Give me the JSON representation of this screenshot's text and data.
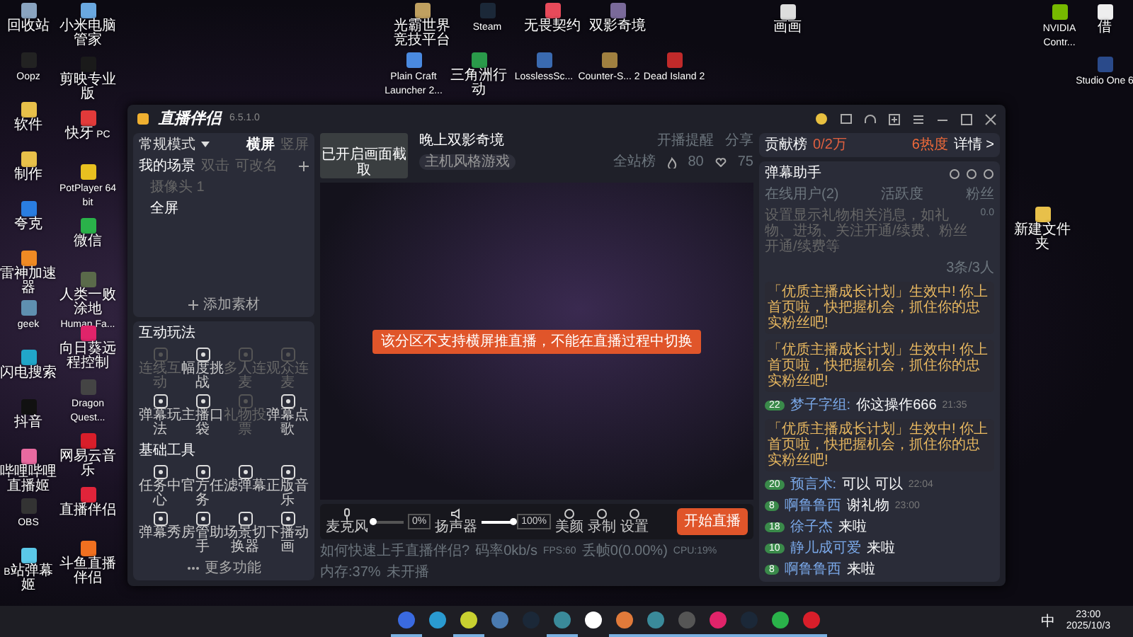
{
  "desktop": {
    "left_columns": [
      [
        {
          "label": "回收站",
          "color": "#8aa4c0"
        },
        {
          "label": "Oopz",
          "color": "#222222"
        },
        {
          "label": "软件",
          "color": "#e8c04a"
        },
        {
          "label": "制作",
          "color": "#e8c04a"
        },
        {
          "label": "夸克",
          "color": "#2a7de1"
        },
        {
          "label": "雷神加速器",
          "color": "#f08a24"
        },
        {
          "label": "geek",
          "color": "#5f8fb0"
        },
        {
          "label": "闪电搜索",
          "color": "#21a6c9"
        },
        {
          "label": "抖音",
          "color": "#111111"
        },
        {
          "label": "哔哩哔哩直播姬",
          "color": "#e86aa0"
        },
        {
          "label": "OBS",
          "color": "#333333"
        },
        {
          "label": "B站弹幕姬",
          "color": "#5bc8e8"
        }
      ],
      [
        {
          "label": "小米电脑管家",
          "color": "#6aa8e0"
        },
        {
          "label": "剪映专业版",
          "color": "#1a1a1a"
        },
        {
          "label": "快牙 PC",
          "color": "#e23a3a"
        },
        {
          "label": "PotPlayer 64 bit",
          "color": "#e8c020"
        },
        {
          "label": "微信",
          "color": "#2ab24a"
        },
        {
          "label": "人类一败涂地 Human Fa...",
          "color": "#5a6a4a"
        },
        {
          "label": "向日葵远程控制",
          "color": "#e0246a"
        },
        {
          "label": "Dragon Quest...",
          "color": "#444444"
        },
        {
          "label": "网易云音乐",
          "color": "#d81e2a"
        },
        {
          "label": "直播伴侣",
          "color": "#e0243a"
        },
        {
          "label": "斗鱼直播伴侣",
          "color": "#f07020"
        }
      ]
    ],
    "top_rows": [
      [
        {
          "label": "光霸世界竞技平台",
          "color": "#c0a060"
        },
        {
          "label": "Steam",
          "color": "#1b2838"
        },
        {
          "label": "无畏契约",
          "color": "#e84a5a"
        },
        {
          "label": "双影奇境",
          "color": "#7a6a9a"
        }
      ],
      [
        {
          "label": "Plain Craft Launcher 2...",
          "color": "#4a8ae0"
        },
        {
          "label": "三角洲行动",
          "color": "#2a9a4a"
        },
        {
          "label": "LosslessSc...",
          "color": "#3a6ab0"
        },
        {
          "label": "Counter-S... 2",
          "color": "#a08040"
        },
        {
          "label": "Dead Island 2",
          "color": "#c02a2a"
        }
      ]
    ],
    "right_items": [
      {
        "label": "画画",
        "color": "#dddddd"
      },
      {
        "label": "NVIDIA Contr...",
        "color": "#76b900"
      },
      {
        "label": "借",
        "color": "#eeeeee"
      },
      {
        "label": "Studio One 6",
        "color": "#2a4a8a"
      },
      {
        "label": "新建文件夹",
        "color": "#e8c04a"
      }
    ]
  },
  "app": {
    "title": "直播伴侣",
    "version": "6.5.1.0",
    "mode": {
      "label": "常规模式",
      "orientations": [
        {
          "label": "横屏",
          "selected": true
        },
        {
          "label": "竖屏",
          "selected": false
        }
      ]
    },
    "scenes": {
      "title": "我的场景",
      "hints": [
        "双击",
        "可改名"
      ],
      "items": [
        {
          "label": "摄像头 1",
          "disabled": true
        },
        {
          "label": "全屏",
          "disabled": false
        }
      ],
      "add_label": "添加素材"
    },
    "interactive": {
      "title": "互动玩法",
      "items": [
        {
          "label": "连线互动",
          "disabled": true
        },
        {
          "label": "幅度挑战",
          "disabled": false
        },
        {
          "label": "多人连麦",
          "disabled": true
        },
        {
          "label": "观众连麦",
          "disabled": true
        },
        {
          "label": "弹幕玩法",
          "disabled": false
        },
        {
          "label": "主播口袋",
          "disabled": false
        },
        {
          "label": "礼物投票",
          "disabled": true
        },
        {
          "label": "弹幕点歌",
          "disabled": false
        }
      ]
    },
    "tools": {
      "title": "基础工具",
      "items": [
        {
          "label": "任务中心",
          "disabled": false
        },
        {
          "label": "官方任务",
          "disabled": false
        },
        {
          "label": "滤弹幕",
          "disabled": false
        },
        {
          "label": "正版音乐",
          "disabled": false
        },
        {
          "label": "弹幕秀",
          "disabled": false
        },
        {
          "label": "房管助手",
          "disabled": false
        },
        {
          "label": "场景切换器",
          "disabled": false
        },
        {
          "label": "下播动画",
          "disabled": false
        }
      ]
    },
    "more_label": "更多功能",
    "stream": {
      "thumbnail_caption": "已开启画面截取",
      "title": "晚上双影奇境",
      "category": "主机风格游戏",
      "remind": "开播提醒",
      "share": "分享",
      "rank": "全站榜",
      "likes": "80",
      "fans": "75",
      "notice": "该分区不支持横屏推直播，不能在直播过程中切换"
    },
    "audio": [
      {
        "label": "麦克风",
        "level": 0,
        "reading": "0%"
      },
      {
        "label": "扬声器",
        "level": 1,
        "reading": "100%"
      }
    ],
    "actions": [
      "美颜",
      "录制",
      "设置"
    ],
    "start_button": "开始直播",
    "help": "如何快速上手直播伴侣?",
    "stats": [
      "码率0kb/s",
      "FPS:60",
      "丢帧0(0.00%)",
      "CPU:19%",
      "内存:37%",
      "未开播"
    ],
    "contribution": {
      "label": "贡献榜",
      "value": "0/2万",
      "heat": "6热度",
      "details": "详情 >"
    },
    "assistant": {
      "title": "弹幕助手",
      "tabs": [
        "在线用户(2)",
        "活跃度",
        "粉丝"
      ],
      "tip": "设置显示礼物相关消息，如礼物、进场、关注开通/续费、粉丝开通/续费等",
      "score": "0.0",
      "count": "3条/3人",
      "messages": [
        {
          "kind": "system",
          "text": "「优质主播成长计划」生效中! 你上首页啦，快把握机会，抓住你的忠实粉丝吧!"
        },
        {
          "kind": "system",
          "text": "「优质主播成长计划」生效中! 你上首页啦，快把握机会，抓住你的忠实粉丝吧!"
        },
        {
          "kind": "chat",
          "level": "22",
          "user": "梦子字组:",
          "text": "你这操作666",
          "time": "21:35"
        },
        {
          "kind": "system",
          "text": "「优质主播成长计划」生效中! 你上首页啦，快把握机会，抓住你的忠实粉丝吧!"
        },
        {
          "kind": "chat",
          "level": "20",
          "user": "预言术:",
          "text": "可以 可以",
          "time": "22:04"
        },
        {
          "kind": "chat",
          "level": "8",
          "user": "啊鲁鲁西",
          "text": "谢礼物",
          "time": "23:00"
        }
      ],
      "entries": [
        {
          "level": "18",
          "user": "徐子杰",
          "text": "来啦"
        },
        {
          "level": "10",
          "user": "静儿成可爱",
          "text": "来啦"
        },
        {
          "level": "8",
          "user": "啊鲁鲁西",
          "text": "来啦"
        }
      ]
    }
  },
  "taskbar": {
    "apps": [
      {
        "color": "#3a6ae0",
        "active": true
      },
      {
        "color": "#2a9ad0",
        "active": false
      },
      {
        "color": "#c8d030",
        "active": true
      },
      {
        "color": "#4a7ab0",
        "active": false
      },
      {
        "color": "#1b2838",
        "active": false
      },
      {
        "color": "#3a8a9a",
        "active": true
      },
      {
        "color": "#ffffff",
        "active": false
      },
      {
        "color": "#e07a3a",
        "active": true
      },
      {
        "color": "#3a8a9a",
        "active": true
      },
      {
        "color": "#555555",
        "active": true
      },
      {
        "color": "#e0246a",
        "active": true
      },
      {
        "color": "#1b2838",
        "active": true
      },
      {
        "color": "#2ab24a",
        "active": true
      },
      {
        "color": "#d81e2a",
        "active": true
      }
    ],
    "ime": "中",
    "time": "23:00",
    "date": "2025/10/3"
  }
}
